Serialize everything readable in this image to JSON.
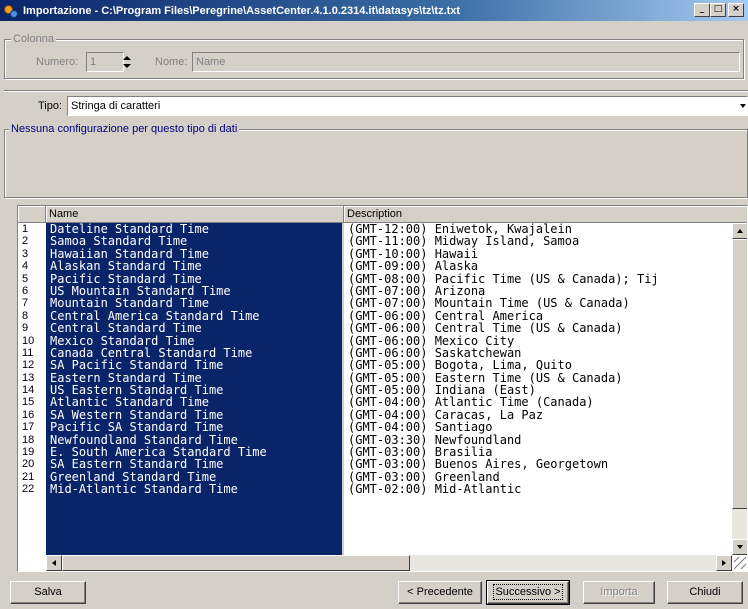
{
  "window": {
    "title": "Importazione - C:\\Program Files\\Peregrine\\AssetCenter.4.1.0.2314.it\\datasys\\tz\\tz.txt",
    "min": "_",
    "max": "□",
    "close": "×"
  },
  "colonna": {
    "group_label": "Colonna",
    "numero_label": "Numero:",
    "numero_value": "1",
    "nome_label": "Nome:",
    "nome_value": "Name"
  },
  "tipo": {
    "label": "Tipo:",
    "value": "Stringa di caratteri"
  },
  "config": {
    "group_label": "Nessuna configurazione per questo tipo di dati"
  },
  "grid": {
    "headers": [
      "Name",
      "Description"
    ],
    "rows": [
      {
        "num": "1",
        "name": "Dateline Standard Time",
        "desc": "(GMT-12:00) Eniwetok, Kwajalein"
      },
      {
        "num": "2",
        "name": "Samoa Standard Time",
        "desc": "(GMT-11:00) Midway Island, Samoa"
      },
      {
        "num": "3",
        "name": "Hawaiian Standard Time",
        "desc": "(GMT-10:00) Hawaii"
      },
      {
        "num": "4",
        "name": "Alaskan Standard Time",
        "desc": "(GMT-09:00) Alaska"
      },
      {
        "num": "5",
        "name": "Pacific Standard Time",
        "desc": "(GMT-08:00) Pacific Time (US & Canada); Tij"
      },
      {
        "num": "6",
        "name": "US Mountain Standard Time",
        "desc": "(GMT-07:00) Arizona"
      },
      {
        "num": "7",
        "name": "Mountain Standard Time",
        "desc": "(GMT-07:00) Mountain Time (US & Canada)"
      },
      {
        "num": "8",
        "name": "Central America Standard Time",
        "desc": "(GMT-06:00) Central America"
      },
      {
        "num": "9",
        "name": "Central Standard Time",
        "desc": "(GMT-06:00) Central Time (US & Canada)"
      },
      {
        "num": "10",
        "name": "Mexico Standard Time",
        "desc": "(GMT-06:00) Mexico City"
      },
      {
        "num": "11",
        "name": "Canada Central Standard Time",
        "desc": "(GMT-06:00) Saskatchewan"
      },
      {
        "num": "12",
        "name": "SA Pacific Standard Time",
        "desc": "(GMT-05:00) Bogota, Lima, Quito"
      },
      {
        "num": "13",
        "name": "Eastern Standard Time",
        "desc": "(GMT-05:00) Eastern Time (US & Canada)"
      },
      {
        "num": "14",
        "name": "US Eastern Standard Time",
        "desc": "(GMT-05:00) Indiana (East)"
      },
      {
        "num": "15",
        "name": "Atlantic Standard Time",
        "desc": "(GMT-04:00) Atlantic Time (Canada)"
      },
      {
        "num": "16",
        "name": "SA Western Standard Time",
        "desc": "(GMT-04:00) Caracas, La Paz"
      },
      {
        "num": "17",
        "name": "Pacific SA Standard Time",
        "desc": "(GMT-04:00) Santiago"
      },
      {
        "num": "18",
        "name": "Newfoundland Standard Time",
        "desc": "(GMT-03:30) Newfoundland"
      },
      {
        "num": "19",
        "name": "E. South America Standard Time",
        "desc": "(GMT-03:00) Brasilia"
      },
      {
        "num": "20",
        "name": "SA Eastern Standard Time",
        "desc": "(GMT-03:00) Buenos Aires, Georgetown"
      },
      {
        "num": "21",
        "name": "Greenland Standard Time",
        "desc": "(GMT-03:00) Greenland"
      },
      {
        "num": "22",
        "name": "Mid-Atlantic Standard Time",
        "desc": "(GMT-02:00) Mid-Atlantic"
      }
    ]
  },
  "buttons": {
    "salva": "Salva",
    "precedente": "< Precedente",
    "successivo": "Successivo >",
    "importa": "Importa",
    "chiudi": "Chiudi"
  },
  "colors": {
    "selection": "#0a246a",
    "face": "#d4d0c8",
    "title_start": "#0a246a",
    "title_end": "#a6caf0",
    "group_label_blue": "#000080"
  }
}
